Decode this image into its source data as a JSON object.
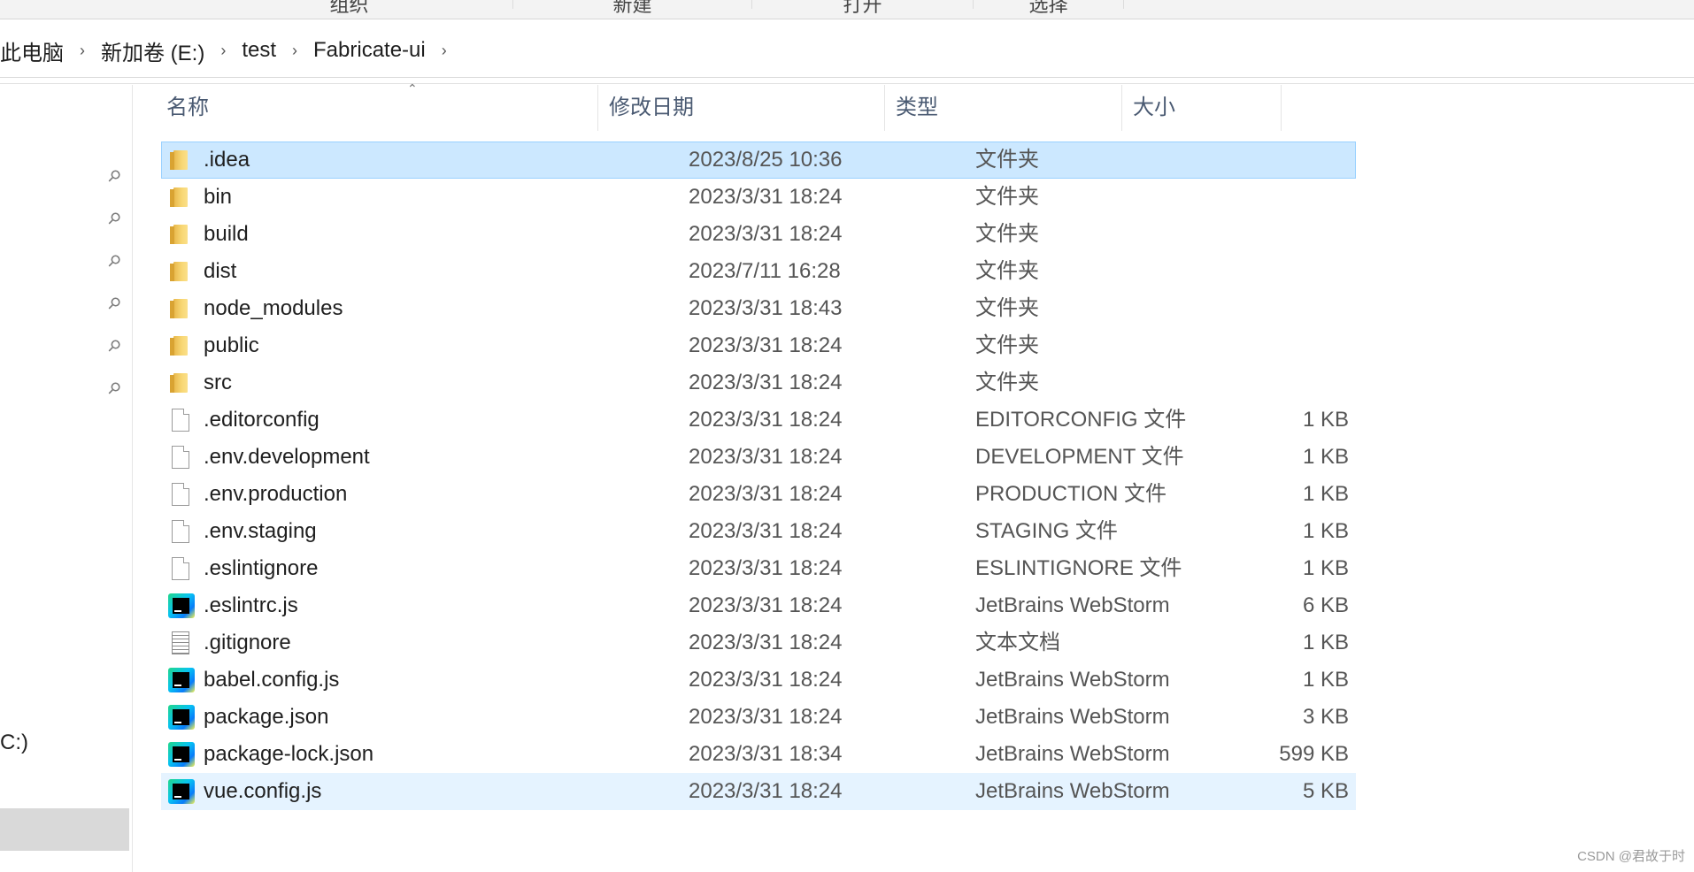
{
  "ribbon": {
    "groups": [
      "组织",
      "新建",
      "打开",
      "选择"
    ]
  },
  "breadcrumb": {
    "items": [
      "此电脑",
      "新加卷 (E:)",
      "test",
      "Fabricate-ui"
    ],
    "separator": "›"
  },
  "nav": {
    "pinned_count": 6,
    "drive_label": "C:)"
  },
  "columns": {
    "name": "名称",
    "date": "修改日期",
    "type": "类型",
    "size": "大小"
  },
  "files": [
    {
      "name": ".idea",
      "date": "2023/8/25 10:36",
      "type": "文件夹",
      "size": "",
      "icon": "folder-icon"
    },
    {
      "name": "bin",
      "date": "2023/3/31 18:24",
      "type": "文件夹",
      "size": "",
      "icon": "folder-icon"
    },
    {
      "name": "build",
      "date": "2023/3/31 18:24",
      "type": "文件夹",
      "size": "",
      "icon": "folder-icon"
    },
    {
      "name": "dist",
      "date": "2023/7/11 16:28",
      "type": "文件夹",
      "size": "",
      "icon": "folder-icon"
    },
    {
      "name": "node_modules",
      "date": "2023/3/31 18:43",
      "type": "文件夹",
      "size": "",
      "icon": "folder-icon"
    },
    {
      "name": "public",
      "date": "2023/3/31 18:24",
      "type": "文件夹",
      "size": "",
      "icon": "folder-icon"
    },
    {
      "name": "src",
      "date": "2023/3/31 18:24",
      "type": "文件夹",
      "size": "",
      "icon": "folder-icon"
    },
    {
      "name": ".editorconfig",
      "date": "2023/3/31 18:24",
      "type": "EDITORCONFIG 文件",
      "size": "1 KB",
      "icon": "file-icon"
    },
    {
      "name": ".env.development",
      "date": "2023/3/31 18:24",
      "type": "DEVELOPMENT 文件",
      "size": "1 KB",
      "icon": "file-icon"
    },
    {
      "name": ".env.production",
      "date": "2023/3/31 18:24",
      "type": "PRODUCTION 文件",
      "size": "1 KB",
      "icon": "file-icon"
    },
    {
      "name": ".env.staging",
      "date": "2023/3/31 18:24",
      "type": "STAGING 文件",
      "size": "1 KB",
      "icon": "file-icon"
    },
    {
      "name": ".eslintignore",
      "date": "2023/3/31 18:24",
      "type": "ESLINTIGNORE 文件",
      "size": "1 KB",
      "icon": "file-icon"
    },
    {
      "name": ".eslintrc.js",
      "date": "2023/3/31 18:24",
      "type": "JetBrains WebStorm",
      "size": "6 KB",
      "icon": "webstorm-icon"
    },
    {
      "name": ".gitignore",
      "date": "2023/3/31 18:24",
      "type": "文本文档",
      "size": "1 KB",
      "icon": "text-file-icon"
    },
    {
      "name": "babel.config.js",
      "date": "2023/3/31 18:24",
      "type": "JetBrains WebStorm",
      "size": "1 KB",
      "icon": "webstorm-icon"
    },
    {
      "name": "package.json",
      "date": "2023/3/31 18:24",
      "type": "JetBrains WebStorm",
      "size": "3 KB",
      "icon": "webstorm-icon"
    },
    {
      "name": "package-lock.json",
      "date": "2023/3/31 18:34",
      "type": "JetBrains WebStorm",
      "size": "599 KB",
      "icon": "webstorm-icon"
    },
    {
      "name": "vue.config.js",
      "date": "2023/3/31 18:24",
      "type": "JetBrains WebStorm",
      "size": "5 KB",
      "icon": "webstorm-icon"
    }
  ],
  "selected_index": 0,
  "hover_index": 17,
  "colors": {
    "selection": "#cce8ff",
    "hover": "#e5f3ff",
    "header_text": "#4a5a72"
  },
  "watermark": "CSDN @君故于时"
}
